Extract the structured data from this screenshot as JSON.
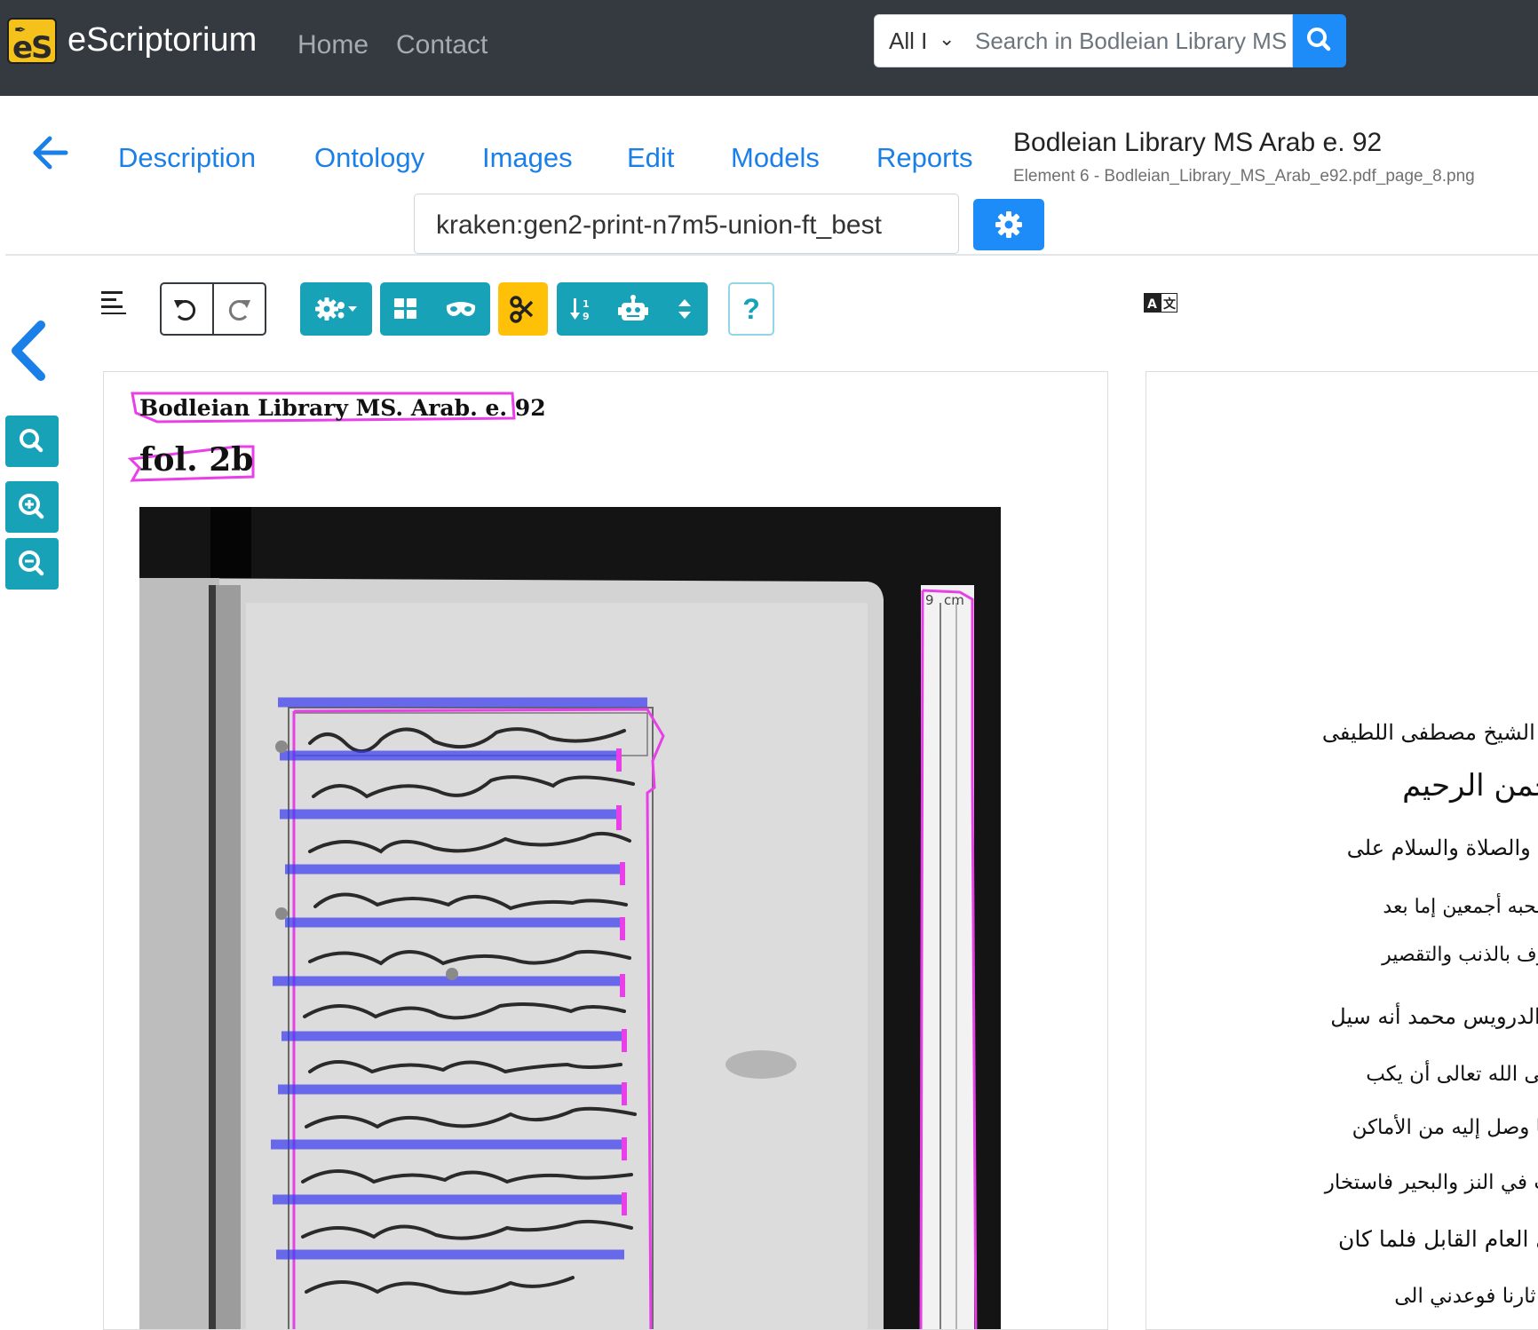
{
  "app": {
    "brand": "eScriptorium",
    "logo_text": "eS",
    "nav": {
      "home": "Home",
      "contact": "Contact"
    }
  },
  "search": {
    "scope": "All I",
    "placeholder": "Search in Bodleian Library MS"
  },
  "document": {
    "tabs": [
      "Description",
      "Ontology",
      "Images",
      "Edit",
      "Models",
      "Reports"
    ],
    "title": "Bodleian Library MS Arab e. 92",
    "subtitle": "Element 6 - Bodleian_Library_MS_Arab_e92.pdf_page_8.png",
    "transcription_model": "kraken:gen2-print-n7m5-union-ft_best"
  },
  "toolbar": {
    "help_label": "?",
    "icons": [
      "lines-icon",
      "undo-icon",
      "redo-icon",
      "settings-icon",
      "regions-icon",
      "mask-icon",
      "cut-icon",
      "sort-icon",
      "robot-icon",
      "sort-updown-icon",
      "translate-icon"
    ]
  },
  "image": {
    "caption": "Bodleian Library MS. Arab. e. 92",
    "folio": "fol. 2b",
    "ruler_label": "cm",
    "ruler_top": "9"
  },
  "transcription": {
    "lines": [
      "ة الشيخ مصطفى اللطيفى",
      "حمن الرحيم",
      "ن والصلاة والسلام على",
      "صحبه أجمعين إما بعد",
      "ترف بالذنب والتقصير",
      "ا الدرويس محمد أنه سيل",
      "إلى الله تعالى أن يكب",
      "ما وصل إليه من الأماكن",
      "ب في النز والبحير فاستخار",
      "ي العام القابل فلما كان",
      "ه ثارنا فوعدني الى"
    ]
  },
  "colors": {
    "navbar": "#343a40",
    "primary": "#1d8cf8",
    "teal": "#17a2b8",
    "warning": "#ffc107",
    "region_outline": "#e83fe8",
    "baseline": "#3c3cf0"
  }
}
